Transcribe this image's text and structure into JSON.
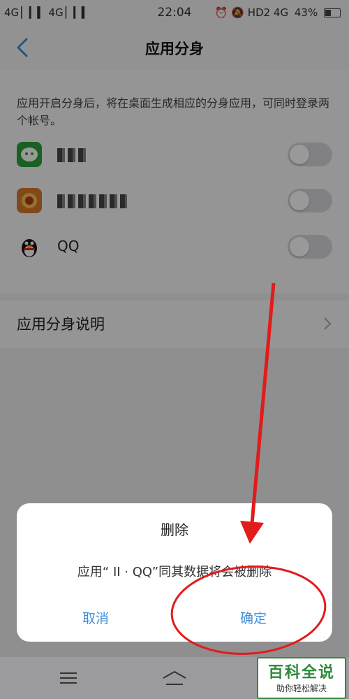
{
  "status_bar": {
    "signal_left": "4G ▏▎▍ 4G ▏▎▍",
    "time": "22:04",
    "right_items": "⏰ 🔕 HD2 4G ",
    "battery_percent": "43%"
  },
  "header": {
    "title": "应用分身"
  },
  "content": {
    "description": "应用开启分身后，将在桌面生成相应的分身应用，可同时登录两个帐号。",
    "apps": [
      {
        "name": "",
        "icon": "wechat-icon",
        "toggle_on": false
      },
      {
        "name": "",
        "icon": "app-icon-orange",
        "toggle_on": false
      },
      {
        "name": "QQ",
        "icon": "qq-penguin-icon",
        "toggle_on": false
      }
    ],
    "explain_label": "应用分身说明"
  },
  "dialog": {
    "title": "删除",
    "message": "应用“ II · QQ”同其数据将会被删除",
    "cancel_label": "取消",
    "confirm_label": "确定"
  },
  "watermark": {
    "title": "百科全说",
    "subtitle": "助你轻松解决"
  },
  "colors": {
    "accent": "#3b8fd8",
    "annotation": "#e21b1b",
    "watermark": "#2e8b3a"
  }
}
